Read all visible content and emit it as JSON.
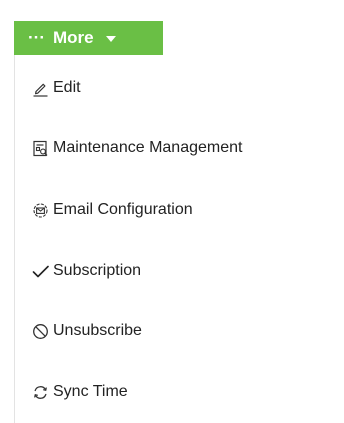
{
  "more_button": {
    "label": "More",
    "dots": "···",
    "background_color": "#6abf45",
    "text_color": "#ffffff",
    "icons": [
      "more-dots-icon",
      "caret-down-icon"
    ]
  },
  "menu": {
    "items": [
      {
        "label": "Edit",
        "icon": "edit-pencil-icon"
      },
      {
        "label": "Maintenance Management",
        "icon": "maintenance-document-icon"
      },
      {
        "label": "Email Configuration",
        "icon": "email-config-icon"
      },
      {
        "label": "Subscription",
        "icon": "checkmark-icon"
      },
      {
        "label": "Unsubscribe",
        "icon": "prohibited-icon"
      },
      {
        "label": "Sync Time",
        "icon": "sync-icon"
      }
    ]
  }
}
